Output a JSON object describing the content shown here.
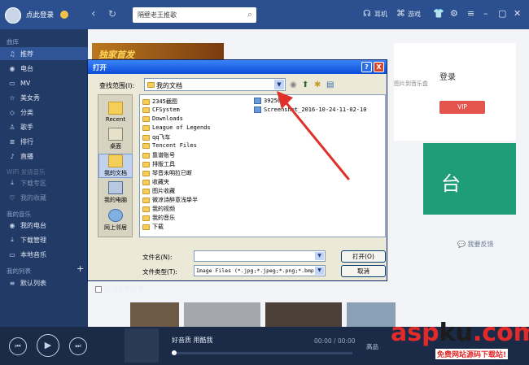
{
  "topbar": {
    "login": "点此登录",
    "search_value": "隔壁老王推歌",
    "earphone": "耳机",
    "games": "游戏"
  },
  "sidebar": {
    "section_library": "曲库",
    "library_items": [
      {
        "label": "推荐",
        "icon": "music-note-icon"
      },
      {
        "label": "电台",
        "icon": "radio-icon"
      },
      {
        "label": "MV",
        "icon": "tv-icon"
      },
      {
        "label": "美女秀",
        "icon": "star-icon"
      },
      {
        "label": "分类",
        "icon": "tag-icon"
      },
      {
        "label": "歌手",
        "icon": "person-icon"
      },
      {
        "label": "排行",
        "icon": "chart-icon"
      },
      {
        "label": "直播",
        "icon": "mic-icon"
      }
    ],
    "section_wifi": "WiFi 发烧音乐",
    "wifi_items": [
      {
        "label": "下载专区"
      },
      {
        "label": "我的收藏"
      }
    ],
    "section_mine": "我的音乐",
    "mine_items": [
      {
        "label": "我的电台"
      },
      {
        "label": "下载管理"
      },
      {
        "label": "本地音乐"
      }
    ],
    "section_lists": "我的列表",
    "add_label": "+",
    "list_items": [
      {
        "label": "默认列表"
      }
    ]
  },
  "main": {
    "banner_text": "独家首发",
    "right_login": "登录",
    "right_hint": "图片到音乐盒",
    "vip": "VIP",
    "green_banner": "台",
    "feedback": "我要反馈"
  },
  "dialog": {
    "title": "打开",
    "help": "?",
    "close": "X",
    "lookin_label": "查找范围(I):",
    "lookin_value": "我的文档",
    "places": [
      "Recent",
      "桌面",
      "我的文档",
      "我的电脑",
      "网上邻居"
    ],
    "folders": [
      "2345截图",
      "CFSystem",
      "Downloads",
      "League of Legends",
      "qq飞车",
      "Tencent Files",
      "靠谱账号",
      "排版工具",
      "琴音未明拉已断",
      "收藏夹",
      "图片收藏",
      "微凉诗醉意浅挚半",
      "我的视频",
      "我的音乐",
      "下载"
    ],
    "files": [
      "392564",
      "Screenshot_2016-10-24-11-02-10"
    ],
    "filename_label": "文件名(N):",
    "filename_value": "",
    "filetype_label": "文件类型(T):",
    "filetype_value": "Image Files (*.jpg;*.jpeg;*.png;*.bmp",
    "open_btn": "打开(O)",
    "cancel_btn": "取消"
  },
  "checkbox_label": "开启歌手写真",
  "player": {
    "title": "好音质 用酷我",
    "time": "00:00 / 00:00",
    "quality": "高品"
  },
  "watermark": {
    "logo_a": "asp",
    "logo_k": "ku",
    "logo_b": ".com",
    "sub": "免费网站源码下载站!"
  },
  "colors": {
    "topbar": "#2b4f8f",
    "sidebar": "#213a66",
    "dialog_title": "#0b4dd8",
    "arrow": "#e0302a"
  }
}
